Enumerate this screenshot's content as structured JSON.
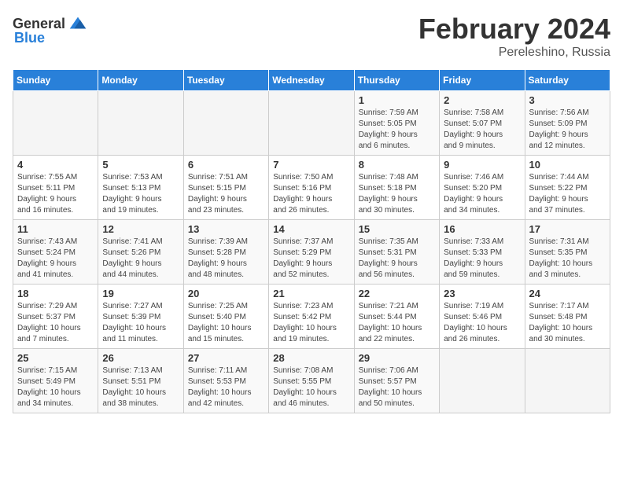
{
  "logo": {
    "text_general": "General",
    "text_blue": "Blue"
  },
  "header": {
    "month": "February 2024",
    "location": "Pereleshino, Russia"
  },
  "weekdays": [
    "Sunday",
    "Monday",
    "Tuesday",
    "Wednesday",
    "Thursday",
    "Friday",
    "Saturday"
  ],
  "weeks": [
    [
      {
        "day": "",
        "info": ""
      },
      {
        "day": "",
        "info": ""
      },
      {
        "day": "",
        "info": ""
      },
      {
        "day": "",
        "info": ""
      },
      {
        "day": "1",
        "info": "Sunrise: 7:59 AM\nSunset: 5:05 PM\nDaylight: 9 hours\nand 6 minutes."
      },
      {
        "day": "2",
        "info": "Sunrise: 7:58 AM\nSunset: 5:07 PM\nDaylight: 9 hours\nand 9 minutes."
      },
      {
        "day": "3",
        "info": "Sunrise: 7:56 AM\nSunset: 5:09 PM\nDaylight: 9 hours\nand 12 minutes."
      }
    ],
    [
      {
        "day": "4",
        "info": "Sunrise: 7:55 AM\nSunset: 5:11 PM\nDaylight: 9 hours\nand 16 minutes."
      },
      {
        "day": "5",
        "info": "Sunrise: 7:53 AM\nSunset: 5:13 PM\nDaylight: 9 hours\nand 19 minutes."
      },
      {
        "day": "6",
        "info": "Sunrise: 7:51 AM\nSunset: 5:15 PM\nDaylight: 9 hours\nand 23 minutes."
      },
      {
        "day": "7",
        "info": "Sunrise: 7:50 AM\nSunset: 5:16 PM\nDaylight: 9 hours\nand 26 minutes."
      },
      {
        "day": "8",
        "info": "Sunrise: 7:48 AM\nSunset: 5:18 PM\nDaylight: 9 hours\nand 30 minutes."
      },
      {
        "day": "9",
        "info": "Sunrise: 7:46 AM\nSunset: 5:20 PM\nDaylight: 9 hours\nand 34 minutes."
      },
      {
        "day": "10",
        "info": "Sunrise: 7:44 AM\nSunset: 5:22 PM\nDaylight: 9 hours\nand 37 minutes."
      }
    ],
    [
      {
        "day": "11",
        "info": "Sunrise: 7:43 AM\nSunset: 5:24 PM\nDaylight: 9 hours\nand 41 minutes."
      },
      {
        "day": "12",
        "info": "Sunrise: 7:41 AM\nSunset: 5:26 PM\nDaylight: 9 hours\nand 44 minutes."
      },
      {
        "day": "13",
        "info": "Sunrise: 7:39 AM\nSunset: 5:28 PM\nDaylight: 9 hours\nand 48 minutes."
      },
      {
        "day": "14",
        "info": "Sunrise: 7:37 AM\nSunset: 5:29 PM\nDaylight: 9 hours\nand 52 minutes."
      },
      {
        "day": "15",
        "info": "Sunrise: 7:35 AM\nSunset: 5:31 PM\nDaylight: 9 hours\nand 56 minutes."
      },
      {
        "day": "16",
        "info": "Sunrise: 7:33 AM\nSunset: 5:33 PM\nDaylight: 9 hours\nand 59 minutes."
      },
      {
        "day": "17",
        "info": "Sunrise: 7:31 AM\nSunset: 5:35 PM\nDaylight: 10 hours\nand 3 minutes."
      }
    ],
    [
      {
        "day": "18",
        "info": "Sunrise: 7:29 AM\nSunset: 5:37 PM\nDaylight: 10 hours\nand 7 minutes."
      },
      {
        "day": "19",
        "info": "Sunrise: 7:27 AM\nSunset: 5:39 PM\nDaylight: 10 hours\nand 11 minutes."
      },
      {
        "day": "20",
        "info": "Sunrise: 7:25 AM\nSunset: 5:40 PM\nDaylight: 10 hours\nand 15 minutes."
      },
      {
        "day": "21",
        "info": "Sunrise: 7:23 AM\nSunset: 5:42 PM\nDaylight: 10 hours\nand 19 minutes."
      },
      {
        "day": "22",
        "info": "Sunrise: 7:21 AM\nSunset: 5:44 PM\nDaylight: 10 hours\nand 22 minutes."
      },
      {
        "day": "23",
        "info": "Sunrise: 7:19 AM\nSunset: 5:46 PM\nDaylight: 10 hours\nand 26 minutes."
      },
      {
        "day": "24",
        "info": "Sunrise: 7:17 AM\nSunset: 5:48 PM\nDaylight: 10 hours\nand 30 minutes."
      }
    ],
    [
      {
        "day": "25",
        "info": "Sunrise: 7:15 AM\nSunset: 5:49 PM\nDaylight: 10 hours\nand 34 minutes."
      },
      {
        "day": "26",
        "info": "Sunrise: 7:13 AM\nSunset: 5:51 PM\nDaylight: 10 hours\nand 38 minutes."
      },
      {
        "day": "27",
        "info": "Sunrise: 7:11 AM\nSunset: 5:53 PM\nDaylight: 10 hours\nand 42 minutes."
      },
      {
        "day": "28",
        "info": "Sunrise: 7:08 AM\nSunset: 5:55 PM\nDaylight: 10 hours\nand 46 minutes."
      },
      {
        "day": "29",
        "info": "Sunrise: 7:06 AM\nSunset: 5:57 PM\nDaylight: 10 hours\nand 50 minutes."
      },
      {
        "day": "",
        "info": ""
      },
      {
        "day": "",
        "info": ""
      }
    ]
  ]
}
